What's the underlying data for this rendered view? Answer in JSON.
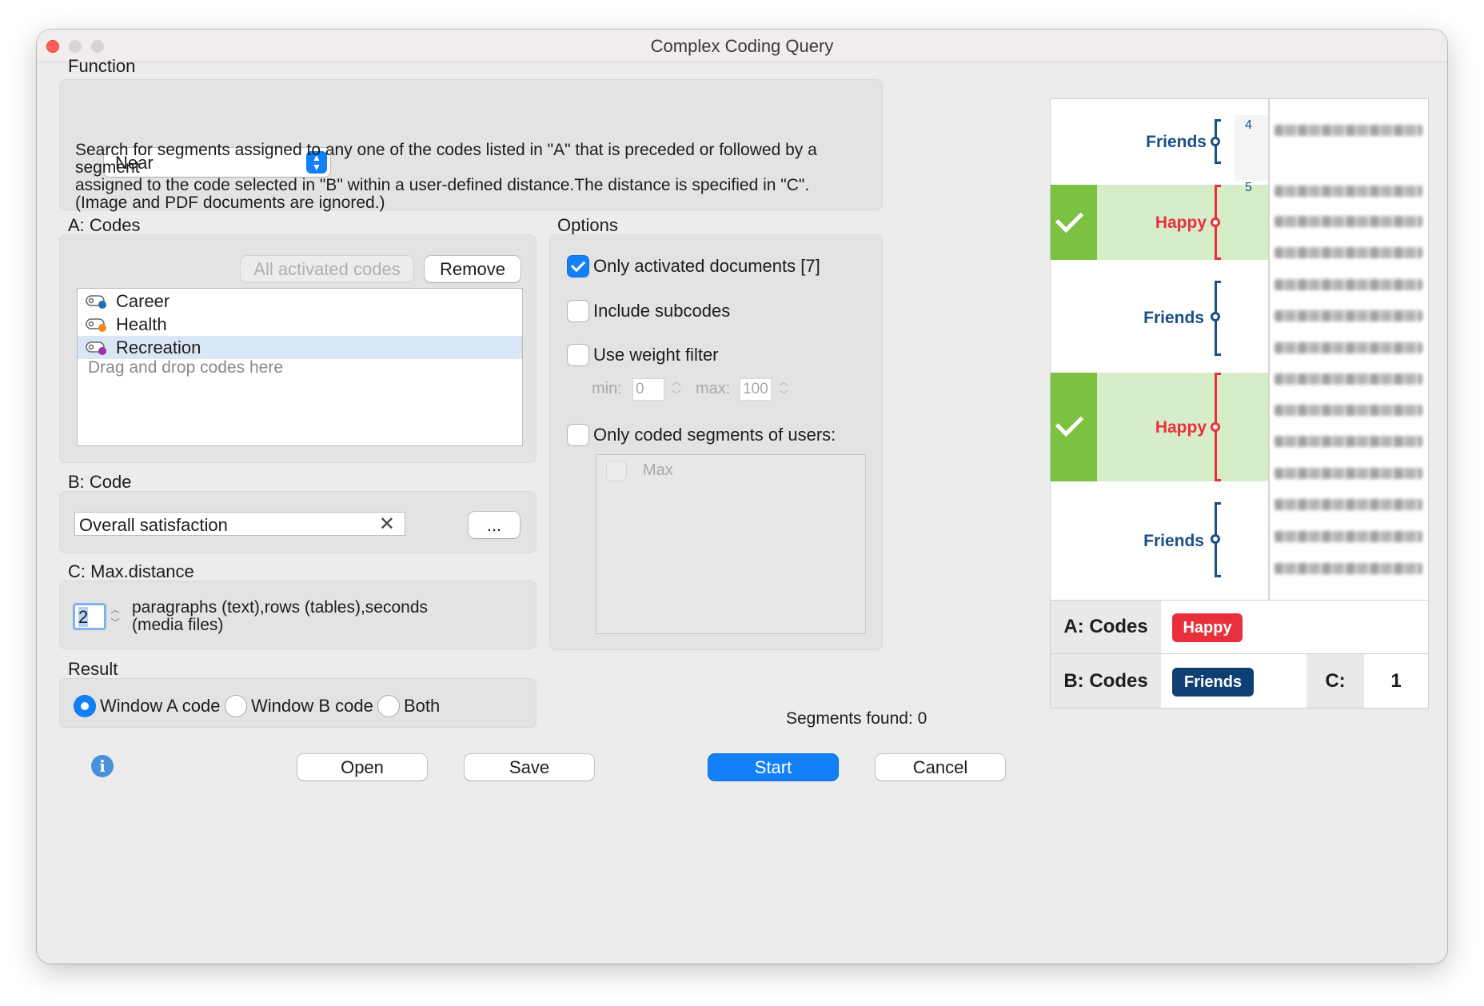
{
  "window": {
    "title": "Complex Coding Query"
  },
  "function": {
    "heading": "Function",
    "selected": "Near",
    "description_lines": [
      "Search for segments assigned to any one of the codes listed in \"A\" that is preceded or followed by a segment",
      "assigned to the code selected in \"B\" within a user-defined distance.The distance  is specified in \"C\".",
      "(Image and PDF documents are ignored.)"
    ]
  },
  "a_codes": {
    "heading": "A: Codes",
    "all_activated_label": "All activated codes",
    "remove_label": "Remove",
    "items": [
      {
        "label": "Career",
        "color": "#1f6fb5"
      },
      {
        "label": "Health",
        "color": "#f28a1c"
      },
      {
        "label": "Recreation",
        "color": "#9b2fae"
      }
    ],
    "selected_index": 2,
    "drop_hint": "Drag and drop codes here"
  },
  "b_code": {
    "heading": "B: Code",
    "value": "Overall satisfaction",
    "browse_label": "..."
  },
  "c_distance": {
    "heading": "C: Max.distance",
    "value": "2",
    "unit_line1": "paragraphs (text),rows (tables),seconds",
    "unit_line2": "(media files)"
  },
  "result": {
    "heading": "Result",
    "options": [
      "Window A code",
      "Window B code",
      "Both"
    ],
    "selected_index": 0
  },
  "options": {
    "heading": "Options",
    "only_activated_docs": {
      "label": "Only activated documents [7]",
      "checked": true
    },
    "include_subcodes": {
      "label": "Include subcodes",
      "checked": false
    },
    "use_weight_filter": {
      "label": "Use weight filter",
      "checked": false
    },
    "weight_min_label": "min:",
    "weight_min_value": "0",
    "weight_max_label": "max:",
    "weight_max_value": "100",
    "only_coded_segments_users": {
      "label": "Only coded segments of users:",
      "checked": false
    },
    "users": [
      "Max"
    ]
  },
  "status": {
    "segments_found": "Segments found: 0"
  },
  "buttons": {
    "open": "Open",
    "save": "Save",
    "start": "Start",
    "cancel": "Cancel",
    "info_glyph": "i"
  },
  "illustration": {
    "paragraph_numbers": [
      "4",
      "5"
    ],
    "bands": [
      {
        "code": "Friends",
        "matched": false
      },
      {
        "code": "Happy",
        "matched": true
      },
      {
        "code": "Friends",
        "matched": false
      },
      {
        "code": "Happy",
        "matched": true
      },
      {
        "code": "Friends",
        "matched": false
      }
    ],
    "legend": {
      "a_label": "A: Codes",
      "a_tag": "Happy",
      "b_label": "B: Codes",
      "b_tag": "Friends",
      "c_label": "C:",
      "c_value": "1"
    },
    "colors": {
      "friends": "#1b4f86",
      "happy": "#e8303c",
      "match_green": "#7cc142",
      "band_green": "#d7ecc9",
      "accent": "#1480f8"
    }
  }
}
